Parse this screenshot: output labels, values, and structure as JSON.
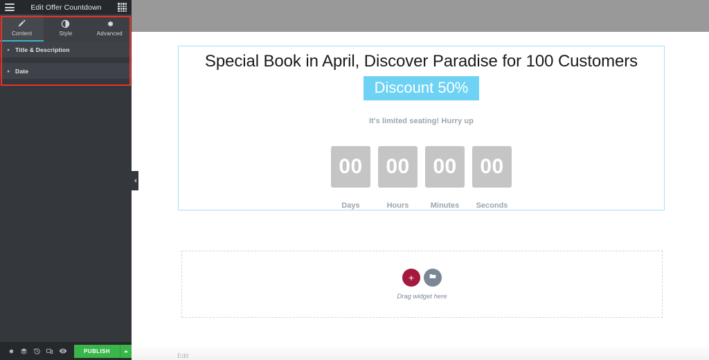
{
  "panel": {
    "header": {
      "title": "Edit Offer Countdown",
      "menu_icon": "hamburger-menu-icon",
      "grid_icon": "apps-grid-icon"
    },
    "tabs": [
      {
        "label": "Content",
        "icon": "pencil-icon",
        "active": true
      },
      {
        "label": "Style",
        "icon": "contrast-icon",
        "active": false
      },
      {
        "label": "Advanced",
        "icon": "gear-icon",
        "active": false
      }
    ],
    "sections": [
      {
        "label": "Title & Description",
        "expanded": false
      },
      {
        "label": "Date",
        "expanded": false
      }
    ],
    "footer": {
      "buttons": [
        {
          "name": "settings-button",
          "icon": "gear-icon"
        },
        {
          "name": "navigator-button",
          "icon": "layers-icon"
        },
        {
          "name": "history-button",
          "icon": "history-icon"
        },
        {
          "name": "responsive-button",
          "icon": "responsive-mode-icon"
        },
        {
          "name": "preview-button",
          "icon": "eye-icon"
        }
      ],
      "publish_label": "PUBLISH",
      "publish_caret_icon": "caret-up-icon"
    },
    "collapse_handle_icon": "chevron-left-icon"
  },
  "canvas": {
    "widget": {
      "title": "Special Book in April, Discover Paradise for 100 Customers",
      "badge": "Discount 50%",
      "subtitle": "It's limited seating! Hurry up",
      "countdown": [
        {
          "value": "00",
          "label": "Days"
        },
        {
          "value": "00",
          "label": "Hours"
        },
        {
          "value": "00",
          "label": "Minutes"
        },
        {
          "value": "00",
          "label": "Seconds"
        }
      ]
    },
    "dropzone": {
      "add_icon": "plus-icon",
      "folder_icon": "folder-icon",
      "text": "Drag widget here"
    },
    "bottom_label": "Edit"
  },
  "colors": {
    "panel_bg": "#34383c",
    "panel_header_bg": "#26292c",
    "tab_active_underline": "#39b4cc",
    "annotation_red": "#ee3124",
    "publish_green": "#39b54a",
    "badge_blue": "#6ed2f5",
    "countdown_grey": "#c5c5c5",
    "selection_border": "#a5dff5",
    "add_button_crimson": "#a4193d",
    "top_strip_grey": "#999999"
  }
}
